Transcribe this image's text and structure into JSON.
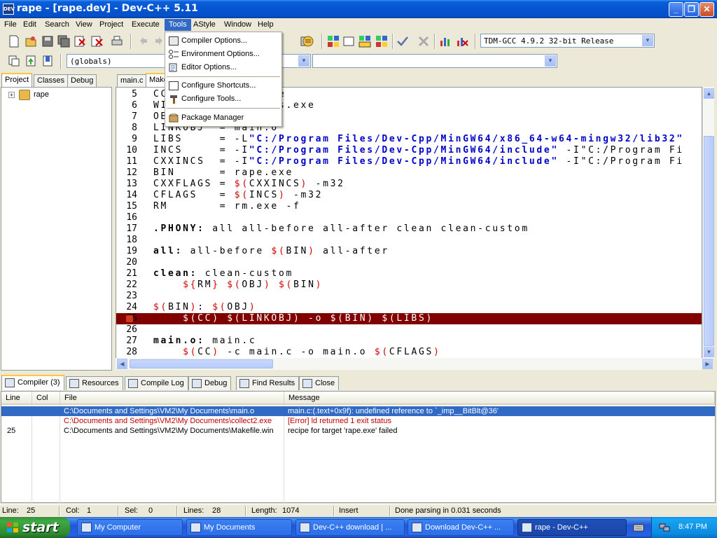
{
  "window": {
    "title": "rape - [rape.dev] - Dev-C++ 5.11",
    "icon_text": "DEV"
  },
  "menu": [
    "File",
    "Edit",
    "Search",
    "View",
    "Project",
    "Execute",
    "Tools",
    "AStyle",
    "Window",
    "Help"
  ],
  "toolbar": {
    "compiler_select": "TDM-GCC 4.9.2 32-bit Release",
    "scope_select": "(globals)"
  },
  "tools_menu": [
    "Compiler Options...",
    "Environment Options...",
    "Editor Options...",
    "Configure Shortcuts...",
    "Configure Tools...",
    "Package Manager"
  ],
  "left_tabs": [
    "Project",
    "Classes",
    "Debug"
  ],
  "project_tree": {
    "root": "rape"
  },
  "editor_tabs": [
    "main.c",
    "Makefile.win"
  ],
  "code": [
    {
      "n": "5",
      "t": "CC       = gcc.exe"
    },
    {
      "n": "6",
      "t": "WINDRES  = windres.exe"
    },
    {
      "n": "7",
      "t": "OBJ      = main.o"
    },
    {
      "n": "8",
      "t": "LINKOBJ  = main.o"
    },
    {
      "n": "9",
      "t": "LIBS     = -L\"C:/Program Files/Dev-Cpp/MinGW64/x86_64-w64-mingw32/lib32\""
    },
    {
      "n": "10",
      "t": "INCS     = -I\"C:/Program Files/Dev-Cpp/MinGW64/include\" -I\"C:/Program Fi"
    },
    {
      "n": "11",
      "t": "CXXINCS  = -I\"C:/Program Files/Dev-Cpp/MinGW64/include\" -I\"C:/Program Fi"
    },
    {
      "n": "12",
      "t": "BIN      = rape.exe"
    },
    {
      "n": "13",
      "t": "CXXFLAGS = $(CXXINCS) -m32"
    },
    {
      "n": "14",
      "t": "CFLAGS   = $(INCS) -m32"
    },
    {
      "n": "15",
      "t": "RM       = rm.exe -f"
    },
    {
      "n": "16",
      "t": ""
    },
    {
      "n": "17",
      "t": ".PHONY: all all-before all-after clean clean-custom"
    },
    {
      "n": "18",
      "t": ""
    },
    {
      "n": "19",
      "t": "all: all-before $(BIN) all-after"
    },
    {
      "n": "20",
      "t": ""
    },
    {
      "n": "21",
      "t": "clean: clean-custom"
    },
    {
      "n": "22",
      "t": "    ${RM} $(OBJ) $(BIN)"
    },
    {
      "n": "23",
      "t": ""
    },
    {
      "n": "24",
      "t": "$(BIN): $(OBJ)"
    },
    {
      "n": "25",
      "t": "    $(CC) $(LINKOBJ) -o $(BIN) $(LIBS)"
    },
    {
      "n": "26",
      "t": ""
    },
    {
      "n": "27",
      "t": "main.o: main.c"
    },
    {
      "n": "28",
      "t": "    $(CC) -c main.c -o main.o $(CFLAGS)"
    }
  ],
  "highlight_line": "25",
  "bottom_tabs": [
    "Compiler (3)",
    "Resources",
    "Compile Log",
    "Debug",
    "Find Results",
    "Close"
  ],
  "messages": {
    "headers": [
      "Line",
      "Col",
      "File",
      "Message"
    ],
    "rows": [
      {
        "line": "",
        "col": "",
        "file": "C:\\Documents and Settings\\VM2\\My Documents\\main.o",
        "msg": "main.c:(.text+0x9f): undefined reference to `_imp__BitBlt@36'"
      },
      {
        "line": "",
        "col": "",
        "file": "C:\\Documents and Settings\\VM2\\My Documents\\collect2.exe",
        "msg": "[Error] ld returned 1 exit status"
      },
      {
        "line": "25",
        "col": "",
        "file": "C:\\Documents and Settings\\VM2\\My Documents\\Makefile.win",
        "msg": "recipe for target 'rape.exe' failed"
      }
    ]
  },
  "status": {
    "line_label": "Line:",
    "line": "25",
    "col_label": "Col:",
    "col": "1",
    "sel_label": "Sel:",
    "sel": "0",
    "lines_label": "Lines:",
    "lines": "28",
    "length_label": "Length:",
    "length": "1074",
    "mode": "Insert",
    "message": "Done parsing in 0.031 seconds"
  },
  "taskbar": {
    "start": "start",
    "tasks": [
      "My Computer",
      "My Documents",
      "Dev-C++ download | ...",
      "Download Dev-C++ ...",
      "rape - Dev-C++"
    ],
    "clock": "8:47 PM"
  },
  "colors": {
    "highlight_line": "#800000",
    "selection": "#316ac5",
    "error_text": "#c00000",
    "string": "#0000c8"
  }
}
